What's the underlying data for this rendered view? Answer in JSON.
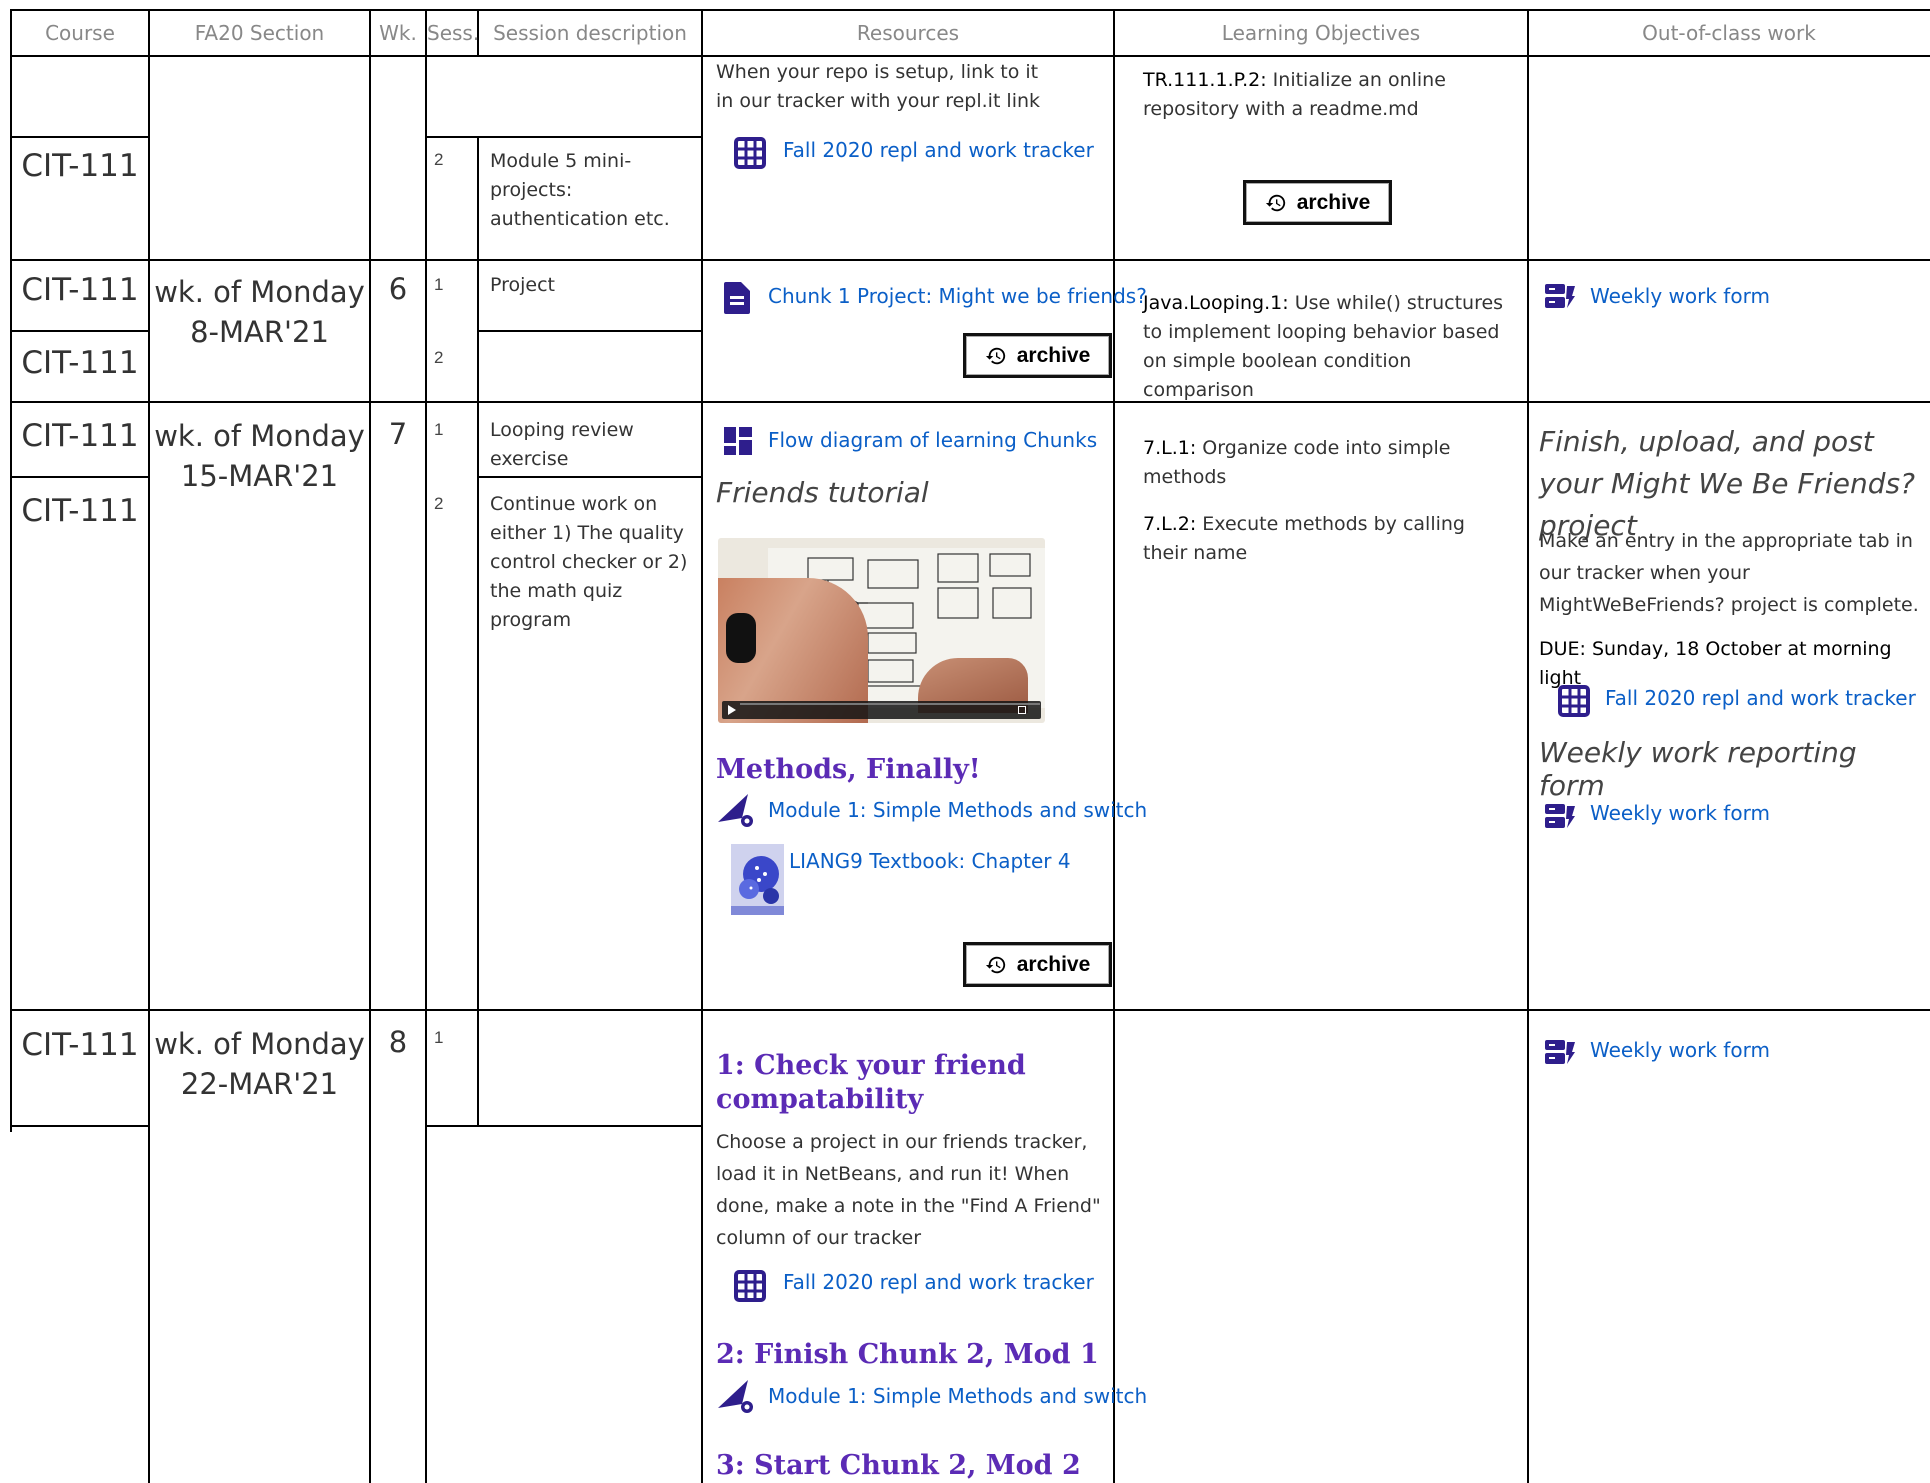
{
  "header": {
    "course": "Course",
    "section": "FA20 Section",
    "week": "Wk.",
    "session": "Sess.",
    "description": "Session description",
    "resources": "Resources",
    "objectives": "Learning Objectives",
    "outwork": "Out-of-class work"
  },
  "rows": {
    "r1": {
      "course": "CIT-111",
      "session": "2",
      "description": "Module 5 mini-projects: authentication etc.",
      "resource_text": "When your repo is setup, link to it in our tracker with your repl.it link",
      "resource_link": "Fall 2020 repl and work tracker",
      "objective_code": "TR.111.1.P.2:",
      "objective_text": " Initialize an online repository with a readme.md",
      "archive": "archive"
    },
    "r2": {
      "course_a": "CIT-111",
      "course_b": "CIT-111",
      "section_line1": "wk. of Monday",
      "section_line2": "8-MAR'21",
      "week": "6",
      "session_a": "1",
      "session_b": "2",
      "description": "Project",
      "resource_link": "Chunk 1 Project: Might we be friends?",
      "archive": "archive",
      "objective_code": "Java.Looping.1:",
      "objective_text": " Use while() structures to implement looping behavior based on simple boolean condition comparison",
      "out_link": "Weekly work form"
    },
    "r3": {
      "course_a": "CIT-111",
      "course_b": "CIT-111",
      "section_line1": "wk. of Monday",
      "section_line2": "15-MAR'21",
      "week": "7",
      "session_a": "1",
      "session_b": "2",
      "description_a": "Looping review exercise",
      "description_b": "Continue work on either 1) The quality control checker or 2) the math quiz program",
      "resource_link1": "Flow diagram of learning Chunks",
      "resource_italic": "Friends tutorial",
      "heading": "Methods, Finally!",
      "resource_link2": "Module 1: Simple Methods and switch",
      "resource_link3": "LIANG9 Textbook: Chapter 4",
      "archive": "archive",
      "objective1_code": "7.L.1:",
      "objective1_text": " Organize code into simple methods",
      "objective2_code": "7.L.2:",
      "objective2_text": " Execute methods by calling their name",
      "out_italic1": "Finish, upload, and post your Might We Be Friends? project",
      "out_text": "Make an entry in the appropriate tab in our tracker when your MightWeBeFriends? project is complete.",
      "out_due": "DUE: Sunday, 18 October at morning light",
      "out_link1": "Fall 2020 repl and work tracker",
      "out_italic2": "Weekly work reporting form",
      "out_link2": "Weekly work form"
    },
    "r4": {
      "course": "CIT-111",
      "section_line1": "wk. of Monday",
      "section_line2": "22-MAR'21",
      "week": "8",
      "session": "1",
      "heading1": "1: Check your friend compatability",
      "text1": "Choose a project in our friends tracker, load it in NetBeans, and run it! When done, make a note in the \"Find A Friend\" column of our tracker",
      "link1": "Fall 2020 repl and work tracker",
      "heading2": "2: Finish Chunk 2, Mod 1",
      "link2": "Module 1: Simple Methods and switch",
      "heading3": "3: Start Chunk 2, Mod 2",
      "out_link": "Weekly work form"
    }
  },
  "colors": {
    "link": "#0b5fc7",
    "heading": "#5b2bb5",
    "icon": "#2e1e8c"
  }
}
